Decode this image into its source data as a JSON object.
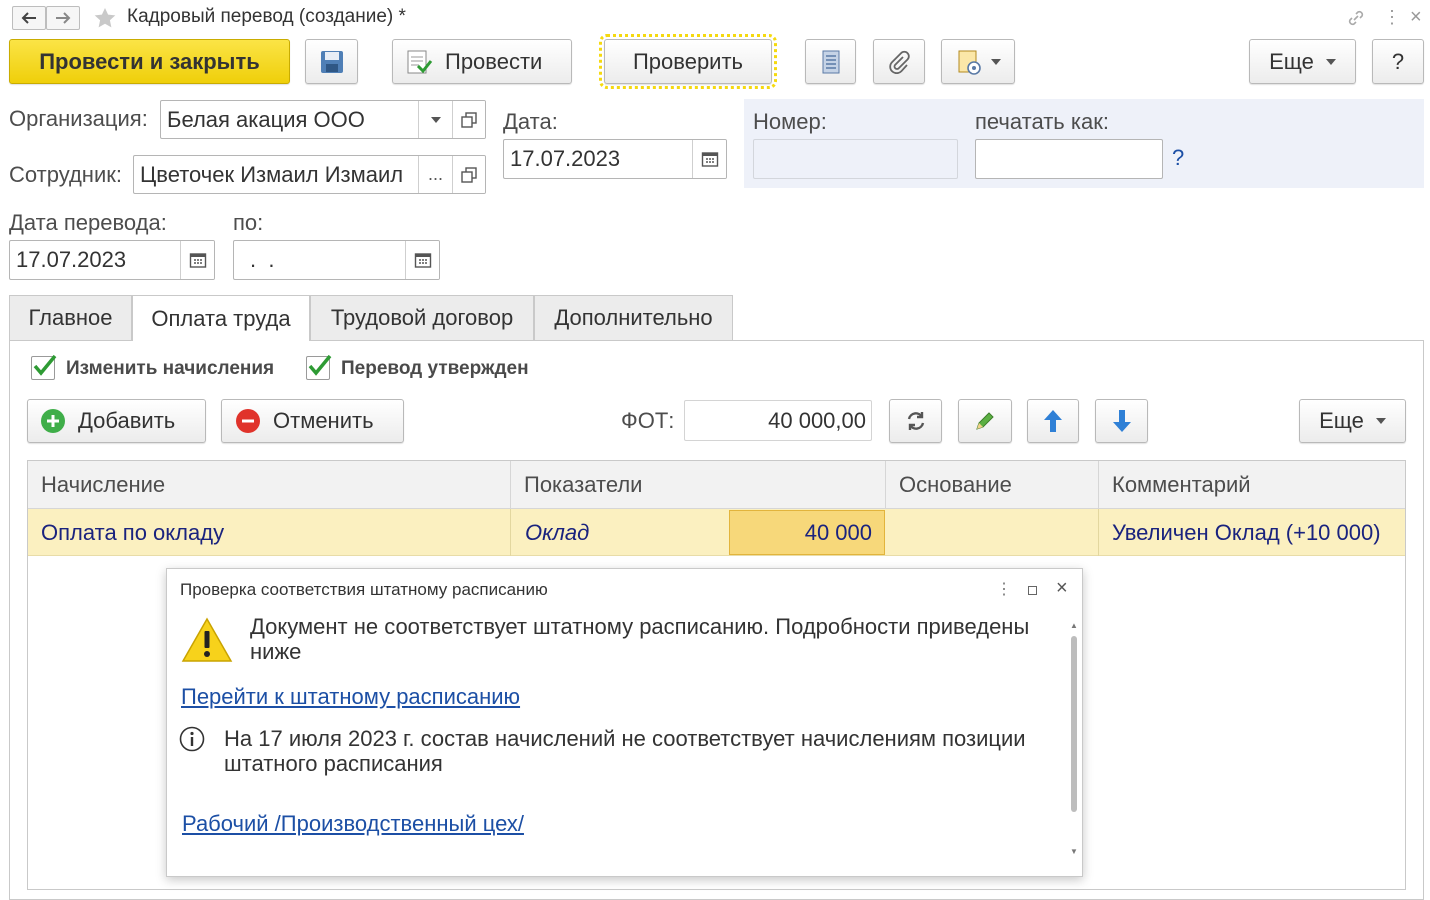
{
  "titlebar": {
    "title": "Кадровый перевод (создание) *",
    "back_icon": "arrow-left-icon",
    "forward_icon": "arrow-right-icon",
    "star_icon": "star-icon"
  },
  "toolbar": {
    "post_and_close": "Провести и закрыть",
    "post": "Провести",
    "check": "Проверить",
    "more": "Еще",
    "help": "?"
  },
  "form": {
    "org_label": "Организация:",
    "org_value": "Белая акация ООО",
    "emp_label": "Сотрудник:",
    "emp_value": "Цветочек Измаил Измаил",
    "emp_ellipsis": "...",
    "date_label": "Дата:",
    "date_value": "17.07.2023",
    "number_label": "Номер:",
    "number_value": "",
    "print_as_label": "печатать как:",
    "print_as_value": "",
    "print_help": "?",
    "transfer_date_label": "Дата перевода:",
    "transfer_date_value": "17.07.2023",
    "to_label": "по:",
    "to_value": ".  ."
  },
  "tabs": [
    {
      "label": "Главное"
    },
    {
      "label": "Оплата труда"
    },
    {
      "label": "Трудовой договор"
    },
    {
      "label": "Дополнительно"
    }
  ],
  "pay": {
    "change_accruals": "Изменить начисления",
    "transfer_approved": "Перевод утвержден",
    "add": "Добавить",
    "cancel": "Отменить",
    "fot_label": "ФОТ:",
    "fot_value": "40 000,00",
    "more": "Еще"
  },
  "table": {
    "headers": [
      "Начисление",
      "Показатели",
      "Основание",
      "Комментарий"
    ],
    "rows": [
      {
        "accrual": "Оплата по окладу",
        "indicator": "Оклад",
        "indicator_value": "40 000",
        "basis": "",
        "comment": "Увеличен Оклад (+10 000)"
      }
    ]
  },
  "dialog": {
    "title": "Проверка соответствия штатному расписанию",
    "message": "Документ не соответствует штатному расписанию. Подробности приведены ниже",
    "link_schedule": "Перейти к штатному расписанию",
    "info": "На 17 июля 2023 г. состав начислений не соответствует начислениям позиции штатного расписания",
    "link_position": "Рабочий /Производственный цех/"
  },
  "colors": {
    "accent_yellow": "#f5d90f",
    "selected_row": "#fbf0c0",
    "selected_cell": "#f7d87a",
    "link": "#1c4fa5"
  }
}
